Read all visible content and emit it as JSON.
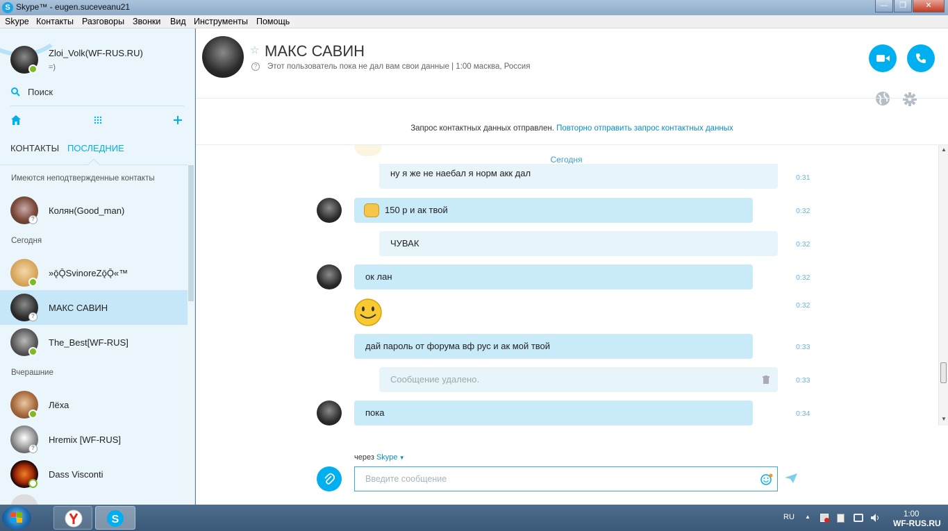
{
  "window": {
    "title": "Skype™ - eugen.suceveanu21",
    "app_glyph": "S",
    "min_label": "—",
    "max_label": "❐",
    "close_label": "✕"
  },
  "menu": [
    "Skype",
    "Контакты",
    "Разговоры",
    "Звонки",
    "Вид",
    "Инструменты",
    "Помощь"
  ],
  "profile": {
    "name": "Zloi_Volk(WF-RUS.RU)",
    "mood": "=)"
  },
  "search": {
    "label": "Поиск"
  },
  "sidebar": {
    "tabs": {
      "contacts": "КОНТАКТЫ",
      "recent": "ПОСЛЕДНИЕ"
    },
    "unconfirmed_header": "Имеются неподтвержденные контакты",
    "today_header": "Сегодня",
    "yesterday_header": "Вчерашние",
    "items": [
      {
        "name": "Колян(Good_man)",
        "status": "unknown"
      },
      {
        "name": "»ǭǬSvinoreZǭǬ«™",
        "status": "online"
      },
      {
        "name": "МАКС САВИН",
        "status": "unknown"
      },
      {
        "name": "The_Best[WF-RUS]",
        "status": "online"
      },
      {
        "name": "Лёха",
        "status": "online"
      },
      {
        "name": "Hremix [WF-RUS]",
        "status": "unknown"
      },
      {
        "name": "Dass Visconti",
        "status": "away"
      }
    ],
    "status_glyph_unknown": "?"
  },
  "conversation": {
    "name": "МАКС САВИН",
    "star": "☆",
    "info_glyph": "?",
    "info": "Этот пользователь пока не дал вам свои данные | 1:00 масква, Россия",
    "notice": "Запрос контактных данных отправлен.",
    "notice_link": "Повторно отправить запрос контактных данных",
    "date_divider": "Сегодня"
  },
  "messages": [
    {
      "text": "ну я же не наебал я норм акк дал",
      "time": "0:31",
      "side": "out"
    },
    {
      "text": "150 р и ак твой",
      "time": "0:32",
      "side": "in"
    },
    {
      "text": "ЧУВАК",
      "time": "0:32",
      "side": "out"
    },
    {
      "text": "ок лан",
      "time": "0:32",
      "side": "in"
    },
    {
      "text": "",
      "time": "0:32",
      "side": "in"
    },
    {
      "text": "дай пароль от форума вф рус и ак мой твой",
      "time": "0:33",
      "side": "in"
    },
    {
      "text": "Сообщение удалено.",
      "time": "0:33",
      "side": "out"
    },
    {
      "text": "пока",
      "time": "0:34",
      "side": "in"
    }
  ],
  "compose": {
    "via_prefix": "через",
    "via_link": "Skype",
    "placeholder": "Введите сообщение"
  },
  "taskbar": {
    "lang": "RU",
    "time": "1:00",
    "watermark": "WF-RUS.RU"
  },
  "colors": {
    "accent": "#00aff0",
    "sidebar_bg": "#eaf6fc",
    "incoming_bubble": "#c8eaf9",
    "outgoing_bubble": "#e7f4fa",
    "online": "#7cbb24"
  }
}
